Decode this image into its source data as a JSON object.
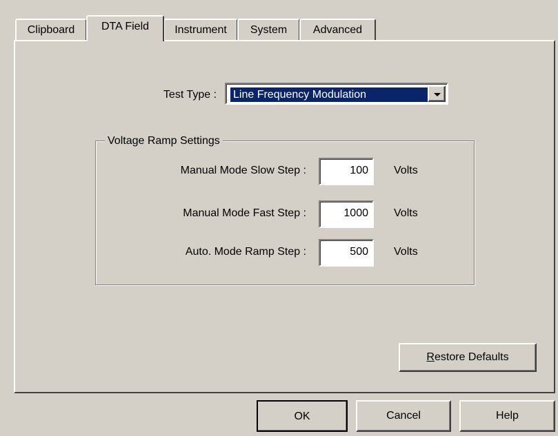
{
  "tabs": [
    {
      "label": "Clipboard",
      "active": false
    },
    {
      "label": "DTA Field",
      "active": true
    },
    {
      "label": "Instrument",
      "active": false
    },
    {
      "label": "System",
      "active": false
    },
    {
      "label": "Advanced",
      "active": false
    }
  ],
  "test_type": {
    "label": "Test Type :",
    "value": "Line Frequency Modulation"
  },
  "voltage_ramp": {
    "title": "Voltage Ramp Settings",
    "rows": [
      {
        "label": "Manual Mode Slow Step :",
        "value": "100",
        "unit": "Volts"
      },
      {
        "label": "Manual Mode Fast Step :",
        "value": "1000",
        "unit": "Volts"
      },
      {
        "label": "Auto. Mode Ramp Step :",
        "value": "500",
        "unit": "Volts"
      }
    ]
  },
  "buttons": {
    "restore_defaults": {
      "mnemonic": "R",
      "rest": "estore Defaults"
    },
    "ok": "OK",
    "cancel": "Cancel",
    "help": "Help"
  },
  "colors": {
    "face": "#d4d0c8",
    "selection": "#0a246a"
  }
}
